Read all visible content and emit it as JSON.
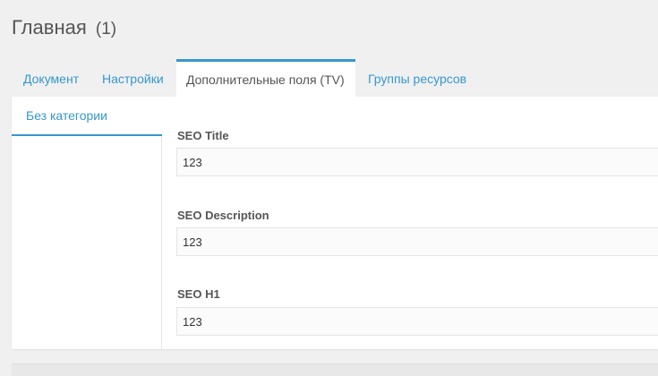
{
  "page": {
    "title": "Главная",
    "count": "(1)"
  },
  "tabs": [
    {
      "label": "Документ",
      "active": false
    },
    {
      "label": "Настройки",
      "active": false
    },
    {
      "label": "Дополнительные поля (TV)",
      "active": true
    },
    {
      "label": "Группы ресурсов",
      "active": false
    }
  ],
  "categories": [
    {
      "label": "Без категории",
      "active": true
    }
  ],
  "fields": [
    {
      "label": "SEO Title",
      "value": "123"
    },
    {
      "label": "SEO Description",
      "value": "123"
    },
    {
      "label": "SEO H1",
      "value": "123"
    }
  ],
  "colors": {
    "accent": "#3697cd",
    "text": "#555555",
    "background": "#f0f0f0"
  }
}
